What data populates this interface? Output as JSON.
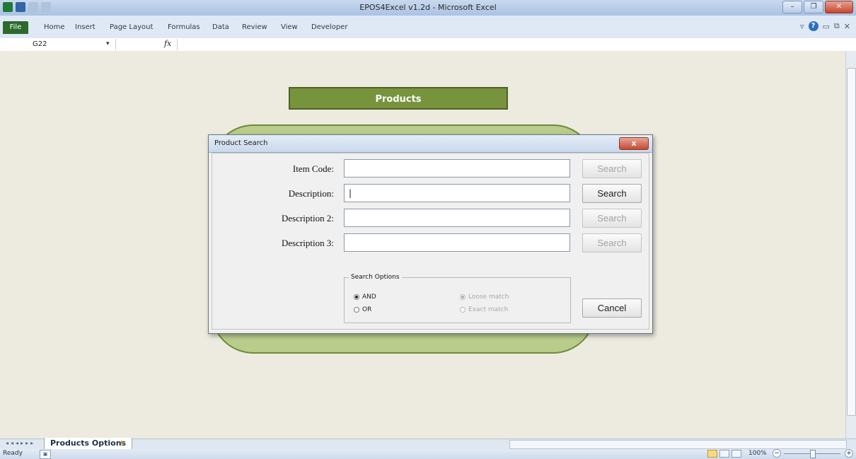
{
  "window": {
    "title": "EPOS4Excel v1.2d - Microsoft Excel",
    "minimize_icon": "minimize-icon",
    "restore_icon": "restore-icon",
    "close_icon": "close-icon"
  },
  "ribbon": {
    "file_tab": "File",
    "tabs": [
      "Home",
      "Insert",
      "Page Layout",
      "Formulas",
      "Data",
      "Review",
      "View",
      "Developer"
    ]
  },
  "formula_bar": {
    "name_box": "G22",
    "fx_label": "fx",
    "content": ""
  },
  "sheet": {
    "banner": "Products"
  },
  "dialog": {
    "title": "Product Search",
    "close_label": "x",
    "fields": [
      {
        "label": "Item Code:",
        "value": "",
        "button": "Search",
        "button_enabled": false
      },
      {
        "label": "Description:",
        "value": "|",
        "button": "Search",
        "button_enabled": true
      },
      {
        "label": "Description 2:",
        "value": "",
        "button": "Search",
        "button_enabled": false
      },
      {
        "label": "Description 3:",
        "value": "",
        "button": "Search",
        "button_enabled": false
      }
    ],
    "options": {
      "legend": "Search Options",
      "and": "AND",
      "or": "OR",
      "loose": "Loose match",
      "exact": "Exact match"
    },
    "cancel": "Cancel"
  },
  "tabbar": {
    "sheet_tab": "Products Options"
  },
  "status": {
    "ready": "Ready",
    "zoom": "100%"
  }
}
